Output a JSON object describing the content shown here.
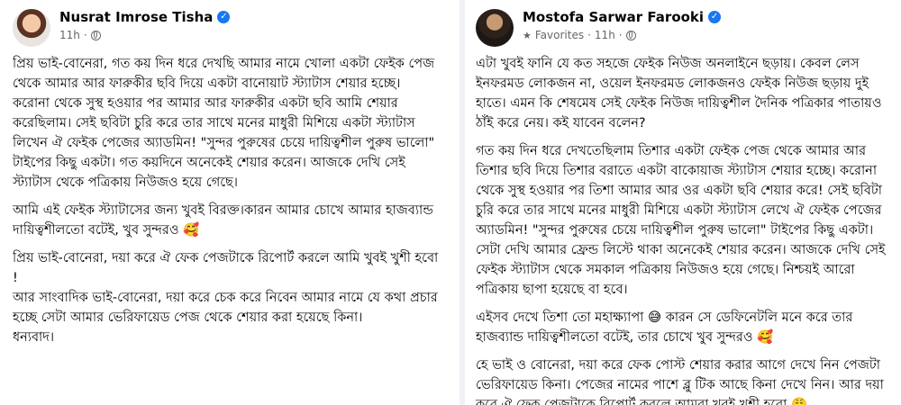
{
  "left_post": {
    "author": "Nusrat Imrose Tisha",
    "time": "11h",
    "separator": "·",
    "paragraphs": [
      "প্রিয় ভাই-বোনেরা, গত কয় দিন ধরে দেখছি আমার নামে খোলা একটা ফেইক পেজ থেকে আমার আর ফারুকীর ছবি দিয়ে একটা বানোয়াট স্ট্যাটাস শেয়ার হচ্ছে।\nকরোনা থেকে সুস্থ হওয়ার পর আমার আর ফারুকীর একটা ছবি আমি শেয়ার করেছিলাম। সেই ছবিটা চুরি করে তার সাথে মনের মাধুরী মিশিয়ে একটা স্ট্যাটাস লিখেন ঐ ফেইক পেজের অ্যাডমিন! \"সুন্দর পুরুষের চেয়ে দায়িত্বশীল পুরুষ ভালো\" টাইপের কিছু একটা। গত কয়দিনে অনেকেই শেয়ার করেন। আজকে দেখি সেই স্ট্যাটাস থেকে পত্রিকায় নিউজও হয়ে গেছে।",
      "আমি এই ফেইক স্ট্যাটাসের জন্য খুবই বিরক্ত।কারন আমার চোখে আমার হাজব্যান্ড দায়িত্বশীলতো বটেই, খুব সুন্দরও 🥰",
      "প্রিয় ভাই-বোনেরা, দয়া করে ঐ ফেক পেজটাকে রিপোর্ট করলে আমি খুবই খুশী হবো !\nআর সাংবাদিক ভাই-বোনেরা, দয়া করে চেক করে নিবেন আমার নামে যে কথা প্রচার হচ্ছে সেটা আমার ভেরিফায়েড পেজ থেকে শেয়ার করা হয়েছে কিনা।\nধন্যবাদ।"
    ]
  },
  "right_post": {
    "author": "Mostofa Sarwar Farooki",
    "audience": "Favorites",
    "time": "11h",
    "separator": "·",
    "paragraphs": [
      "এটা খুবই ফানি যে কত সহজে ফেইক নিউজ অনলাইনে ছড়ায়। কেবল লেস ইনফরমড লোকজন না, ওয়েল ইনফরমড লোকজনও ফেইক নিউজ ছড়ায় দুই হাতে। এমন কি শেষমেষ সেই ফেইক নিউজ দায়িত্বশীল দৈনিক পত্রিকার পাতায়ও ঠাঁই করে নেয়। কই যাবেন বলেন?",
      "গত কয় দিন ধরে দেখতেছিলাম তিশার একটা ফেইক পেজ থেকে আমার আর তিশার ছবি দিয়ে তিশার বরাতে একটা বাকোয়াজ স্ট্যাটাস শেয়ার হচ্ছে। করোনা থেকে সুস্থ হওয়ার পর তিশা আমার আর ওর একটা ছবি শেয়ার করে! সেই ছবিটা চুরি করে তার সাথে মনের মাধুরী মিশিয়ে একটা স্ট্যাটাস লেখে ঐ ফেইক পেজের অ্যাডমিন! \"সুন্দর পুরুষের চেয়ে দায়িত্বশীল পুরুষ ভালো\" টাইপের কিছু একটা। সেটা দেখি আমার ফ্রেন্ড লিস্টে থাকা অনেকেই শেয়ার করেন। আজকে দেখি সেই ফেইক স্ট্যাটাস থেকে সমকাল পত্রিকায় নিউজও হয়ে গেছে। নিশ্চয়ই আরো পত্রিকায় ছাপা হয়েছে বা হবে।",
      "এইসব দেখে তিশা তো মহাক্ষ্যাপা 😅 কারন সে ডেফিনেটলি মনে করে তার হাজব্যান্ড দায়িত্বশীলতো বটেই, তার চোখে খুব সুন্দরও 🥰",
      "হে ভাই ও বোনেরা, দয়া করে ফেক পোস্ট শেয়ার করার আগে দেখে নিন পেজটা ভেরিফায়েড কিনা। পেজের নামের পাশে ব্লু টিক আছে কিনা দেখে নিন। আর দয়া করে ঐ ফেক পেজটাকে রিপোর্ট করলে আমরা খুবই খুশী হবো 😤"
    ]
  },
  "colors": {
    "verified_badge": "#1877f2",
    "meta_text": "#65676b",
    "background_gap": "#f0f2f5"
  },
  "icons": [
    "verified-icon",
    "globe-icon",
    "star-icon"
  ]
}
